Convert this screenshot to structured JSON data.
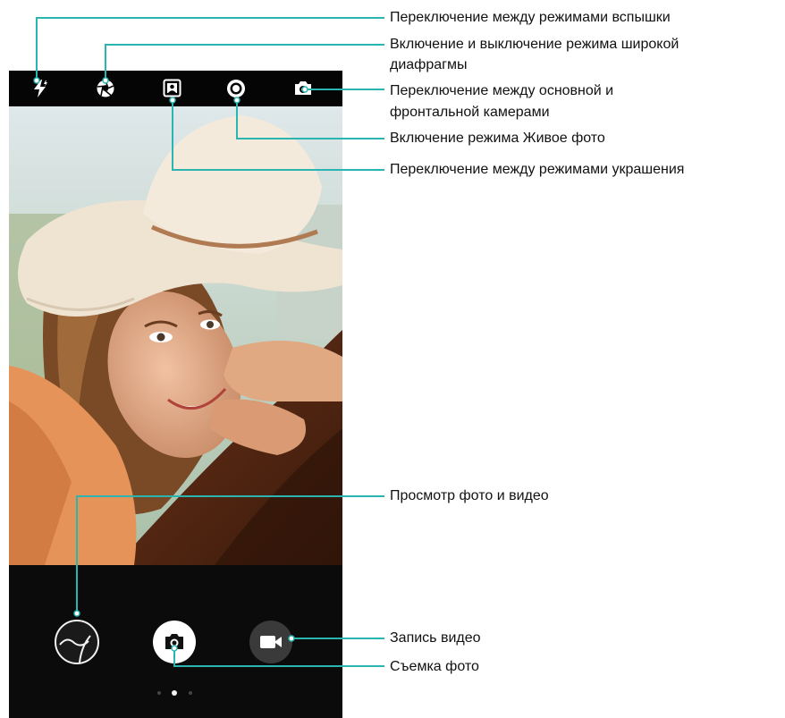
{
  "annotations": {
    "flash": "Переключение между режимами вспышки",
    "aperture_line1": "Включение и выключение режима широкой",
    "aperture_line2": "диафрагмы",
    "switch_camera_line1": "Переключение между основной и",
    "switch_camera_line2": "фронтальной камерами",
    "live_photo": "Включение режима Живое фото",
    "beauty": "Переключение между режимами украшения",
    "gallery": "Просмотр фото и видео",
    "video": "Запись видео",
    "photo": "Съемка фото"
  },
  "icons": {
    "flash": "flash-icon",
    "aperture": "aperture-icon",
    "beauty": "beauty-mode-icon",
    "live_photo": "live-photo-icon",
    "switch_camera": "switch-camera-icon",
    "gallery": "gallery-thumbnail-icon",
    "shutter": "camera-shutter-icon",
    "video": "video-camera-icon"
  },
  "colors": {
    "callout_line": "#2bb5b0",
    "bar_background": "#050505"
  }
}
